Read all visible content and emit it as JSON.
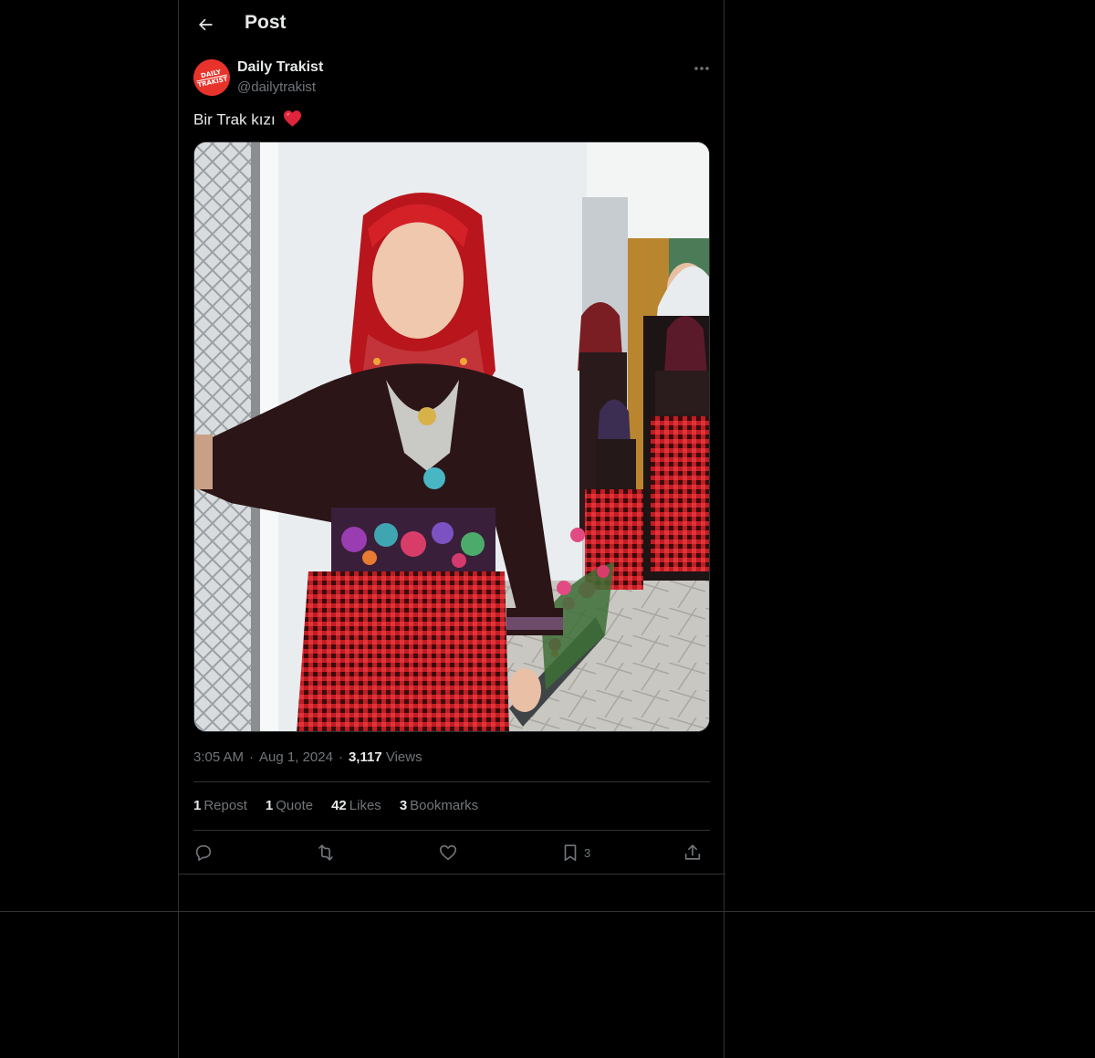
{
  "header": {
    "title": "Post",
    "back_icon": "arrow-left-icon"
  },
  "author": {
    "name": "Daily Trakist",
    "handle": "@dailytrakist",
    "avatar_line1": "DAILY",
    "avatar_line2": "TRAKIST",
    "avatar_color": "#e8332b"
  },
  "tweet": {
    "text": "Bir Trak kızı",
    "emoji": "red-heart-icon",
    "image_alt": "Girl in traditional Thracian costume with red headscarf standing on a balcony; women and girls in similar costumes behind her"
  },
  "meta": {
    "time": "3:05 AM",
    "date": "Aug 1, 2024",
    "views_count": "3,117",
    "views_label": "Views"
  },
  "stats": {
    "reposts_count": "1",
    "reposts_label": "Repost",
    "quotes_count": "1",
    "quotes_label": "Quote",
    "likes_count": "42",
    "likes_label": "Likes",
    "bookmarks_count": "3",
    "bookmarks_label": "Bookmarks"
  },
  "actions": {
    "reply_icon": "reply-icon",
    "repost_icon": "repost-icon",
    "like_icon": "heart-icon",
    "bookmark_icon": "bookmark-icon",
    "bookmark_count": "3",
    "share_icon": "share-icon"
  },
  "colors": {
    "background": "#000000",
    "text_primary": "#e7e9ea",
    "text_secondary": "#71767b",
    "border": "#2f3336",
    "heart_emoji": "#e0243b"
  }
}
